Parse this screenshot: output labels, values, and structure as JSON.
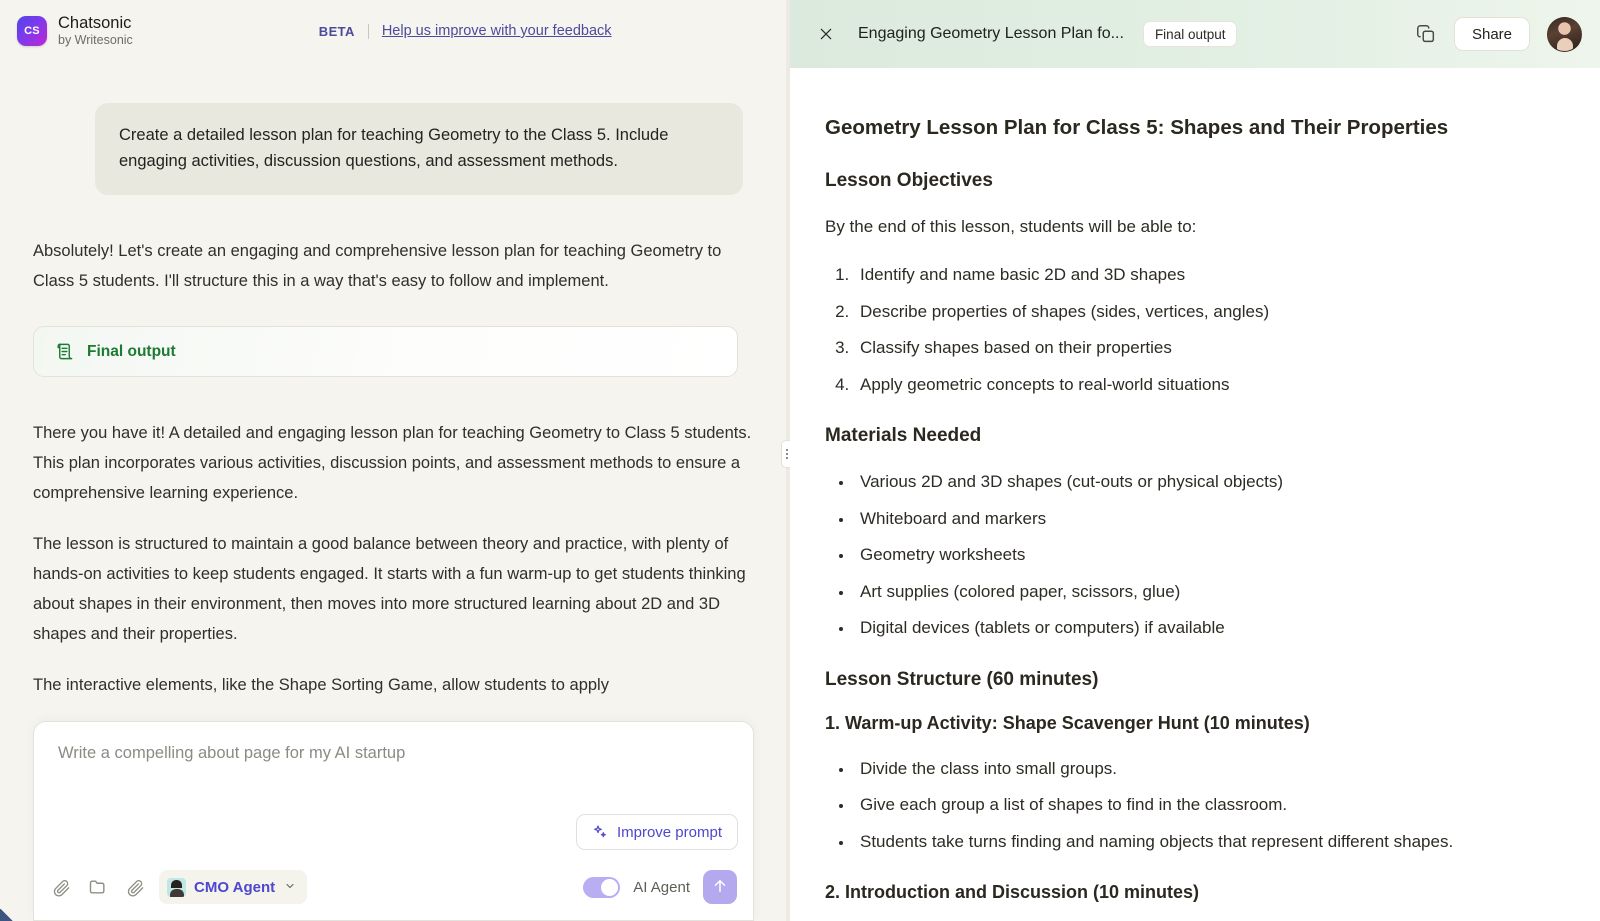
{
  "app": {
    "brand_name": "Chatsonic",
    "brand_sub": "by Writesonic",
    "brand_logo_text": "CS",
    "beta_tag": "BETA",
    "feedback_link": "Help us improve with your feedback"
  },
  "chat": {
    "user_message": "Create a detailed lesson plan for teaching Geometry to the Class 5. Include engaging activities, discussion questions, and assessment methods.",
    "assistant_intro": "Absolutely! Let's create an engaging and comprehensive lesson plan for teaching Geometry to Class 5 students. I'll structure this in a way that's easy to follow and implement.",
    "final_output_label": "Final output",
    "assistant_p1": "There you have it! A detailed and engaging lesson plan for teaching Geometry to Class 5 students. This plan incorporates various activities, discussion points, and assessment methods to ensure a comprehensive learning experience.",
    "assistant_p2": "The lesson is structured to maintain a good balance between theory and practice, with plenty of hands-on activities to keep students engaged. It starts with a fun warm-up to get students thinking about shapes in their environment, then moves into more structured learning about 2D and 3D shapes and their properties.",
    "assistant_p3": "The interactive elements, like the Shape Sorting Game, allow students to apply"
  },
  "composer": {
    "placeholder": "Write a compelling about page for my AI startup",
    "value": "",
    "improve_prompt_label": "Improve prompt",
    "agent_label": "CMO Agent",
    "ai_agent_label": "AI Agent",
    "toggle_on": true,
    "icons": {
      "attach": "paperclip-icon",
      "folder": "folder-icon",
      "feather": "feather-attach-icon",
      "chevron": "chevron-down-icon",
      "send": "send-arrow-up-icon",
      "sparkle": "sparkle-icon"
    }
  },
  "panel": {
    "title": "Engaging Geometry Lesson Plan fo...",
    "badge": "Final output",
    "share_label": "Share",
    "close_icon": "close-icon",
    "copy_icon": "copy-icon",
    "avatar": "user-avatar"
  },
  "document": {
    "title": "Geometry Lesson Plan for Class 5: Shapes and Their Properties",
    "objectives_heading": "Lesson Objectives",
    "objectives_intro": "By the end of this lesson, students will be able to:",
    "objectives": [
      "Identify and name basic 2D and 3D shapes",
      "Describe properties of shapes (sides, vertices, angles)",
      "Classify shapes based on their properties",
      "Apply geometric concepts to real-world situations"
    ],
    "materials_heading": "Materials Needed",
    "materials": [
      "Various 2D and 3D shapes (cut-outs or physical objects)",
      "Whiteboard and markers",
      "Geometry worksheets",
      "Art supplies (colored paper, scissors, glue)",
      "Digital devices (tablets or computers) if available"
    ],
    "structure_heading": "Lesson Structure (60 minutes)",
    "section1_heading": "1. Warm-up Activity: Shape Scavenger Hunt (10 minutes)",
    "section1_items": [
      "Divide the class into small groups.",
      "Give each group a list of shapes to find in the classroom.",
      "Students take turns finding and naming objects that represent different shapes."
    ],
    "section2_heading": "2. Introduction and Discussion (10 minutes)"
  },
  "colors": {
    "background": "#f5f4ef",
    "accent_purple": "#4f46cf",
    "accent_green": "#1d7a33",
    "header_green": "#dceade",
    "bubble": "#e9e8de"
  }
}
